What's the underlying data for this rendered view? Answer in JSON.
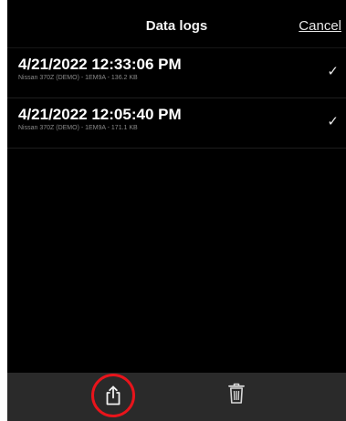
{
  "header": {
    "title": "Data logs",
    "cancel_label": "Cancel"
  },
  "logs": [
    {
      "date": "4/21/2022 12:33:06 PM",
      "detail": "Nissan 370Z (DEMO) - 1EM9A - 136.2 KB",
      "selected": true
    },
    {
      "date": "4/21/2022 12:05:40 PM",
      "detail": "Nissan 370Z (DEMO) - 1EM9A - 171.1 KB",
      "selected": true
    }
  ],
  "icons": {
    "check": "checkmark-icon",
    "share": "share-icon",
    "delete": "trash-icon"
  },
  "colors": {
    "highlight_ring": "#e8141b",
    "background": "#000000",
    "toolbar": "#2a2a2a"
  }
}
